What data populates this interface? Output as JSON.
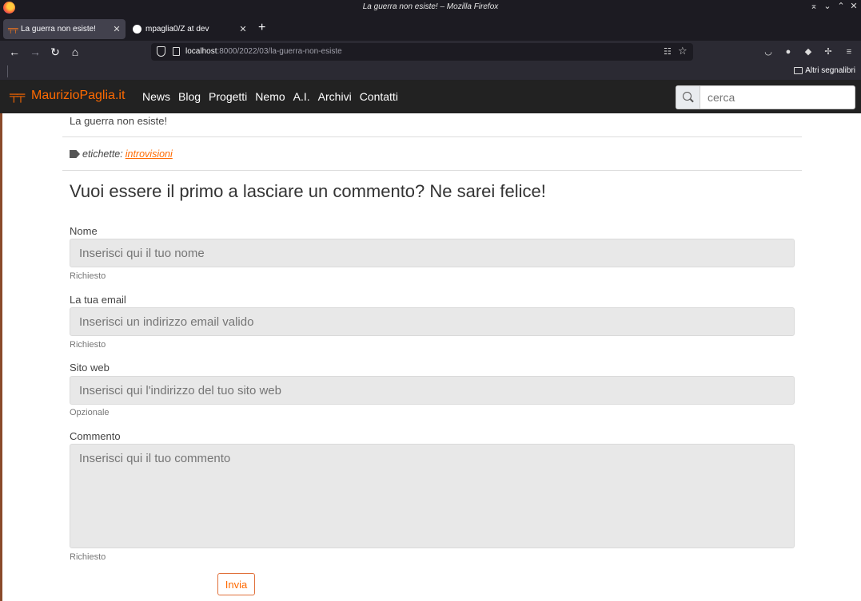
{
  "window": {
    "title": "La guerra non esiste! – Mozilla Firefox"
  },
  "tabs": [
    {
      "label": "La guerra non esiste!",
      "active": true
    },
    {
      "label": "mpaglia0/Z at dev",
      "active": false
    }
  ],
  "urlbar": {
    "host": "localhost",
    "path": ":8000/2022/03/la-guerra-non-esiste"
  },
  "bookmarks": {
    "other_label": "Altri segnalibri"
  },
  "site": {
    "brand": "MaurizioPaglia.it",
    "brand_color": "#ff6a00",
    "menu": [
      "News",
      "Blog",
      "Progetti",
      "Nemo",
      "A.I.",
      "Archivi",
      "Contatti"
    ],
    "search_placeholder": "cerca"
  },
  "post": {
    "excerpt": "La guerra non esiste!",
    "tags_label": "etichette:",
    "tag": "introvisioni"
  },
  "comment_form": {
    "heading": "Vuoi essere il primo a lasciare un commento? Ne sarei felice!",
    "name": {
      "label": "Nome",
      "placeholder": "Inserisci qui il tuo nome",
      "help": "Richiesto"
    },
    "email": {
      "label": "La tua email",
      "placeholder": "Inserisci un indirizzo email valido",
      "help": "Richiesto"
    },
    "website": {
      "label": "Sito web",
      "placeholder": "Inserisci qui l'indirizzo del tuo sito web",
      "help": "Opzionale"
    },
    "comment": {
      "label": "Commento",
      "placeholder": "Inserisci qui il tuo commento",
      "help": "Richiesto"
    },
    "submit_label": "Invia"
  }
}
